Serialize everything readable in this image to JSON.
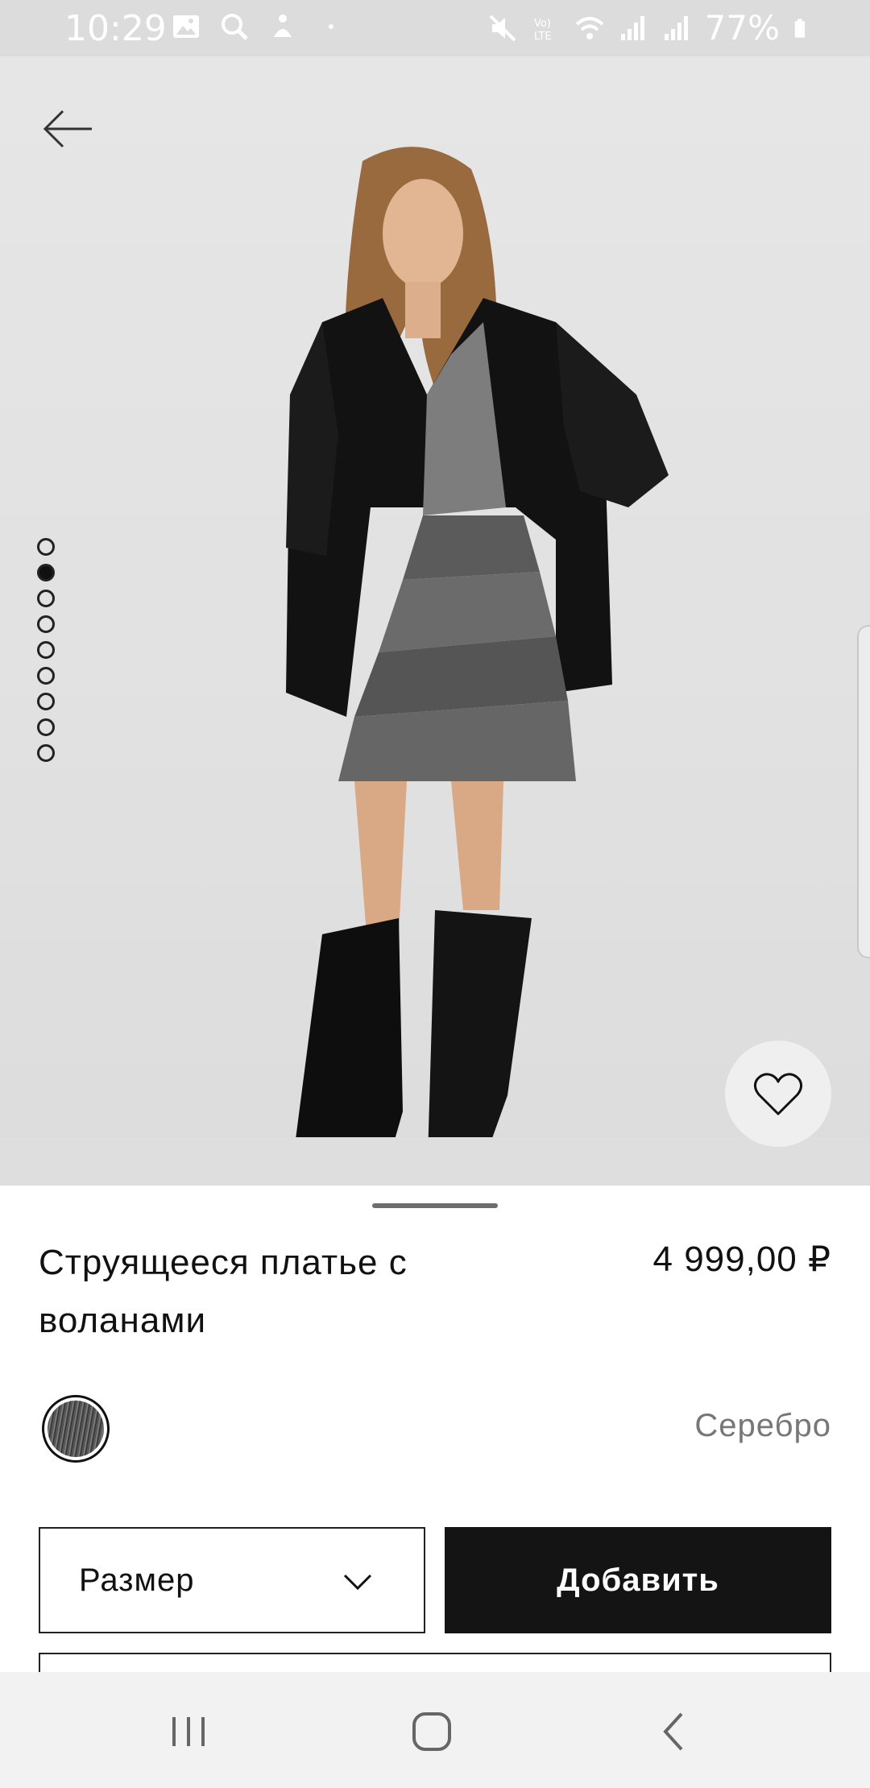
{
  "status_bar": {
    "time": "10:29",
    "battery": "77%",
    "icons": [
      "gallery-icon",
      "search-icon",
      "notification-icon",
      "dot",
      "mute-icon",
      "volte-icon",
      "wifi-icon",
      "signal-icon",
      "signal-icon",
      "battery-icon"
    ]
  },
  "gallery": {
    "total_images": 9,
    "active_index": 1
  },
  "product": {
    "title": "Струящееся платье с воланами",
    "price": "4 999,00 ₽",
    "color_name": "Серебро",
    "size_label": "Размер",
    "add_label": "Добавить"
  },
  "colors": {
    "accent": "#141414",
    "muted_text": "#777777"
  }
}
